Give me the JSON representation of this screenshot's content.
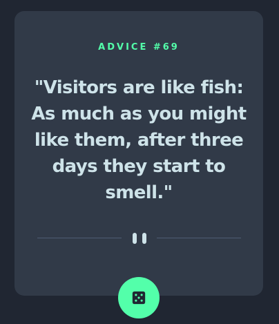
{
  "card": {
    "advice_id": "ADVICE #69",
    "quote": "\"Visitors are like fish: As much as you might like them, after three days they start to smell.\""
  },
  "icons": {
    "divider": "pause-icon",
    "button": "dice-icon"
  },
  "colors": {
    "background": "#202632",
    "card": "#313a48",
    "accent": "#53ffaa",
    "text": "#cee3e9",
    "divider": "#4f5d74"
  }
}
